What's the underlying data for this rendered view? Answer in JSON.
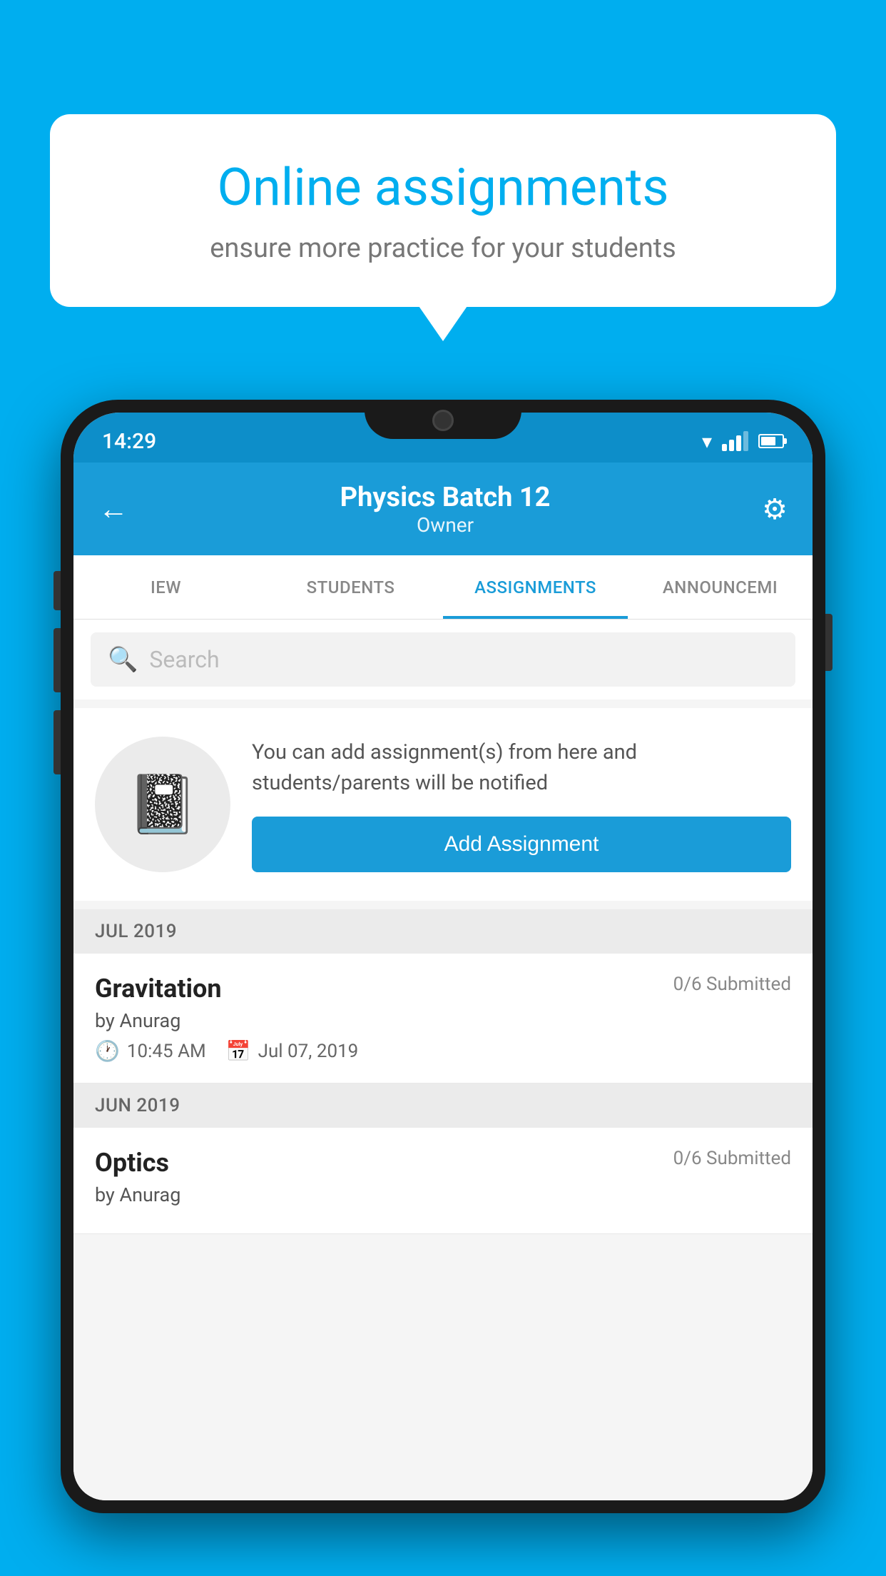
{
  "background_color": "#00AEEF",
  "speech_bubble": {
    "title": "Online assignments",
    "subtitle": "ensure more practice for your students"
  },
  "phone": {
    "status_bar": {
      "time": "14:29"
    },
    "app_bar": {
      "title": "Physics Batch 12",
      "subtitle": "Owner",
      "back_label": "←",
      "settings_label": "⚙"
    },
    "tabs": [
      {
        "label": "IEW",
        "active": false
      },
      {
        "label": "STUDENTS",
        "active": false
      },
      {
        "label": "ASSIGNMENTS",
        "active": true
      },
      {
        "label": "ANNOUNCEMI",
        "active": false
      }
    ],
    "search": {
      "placeholder": "Search"
    },
    "cta": {
      "description": "You can add assignment(s) from here and students/parents will be notified",
      "button_label": "Add Assignment"
    },
    "sections": [
      {
        "label": "JUL 2019",
        "assignments": [
          {
            "name": "Gravitation",
            "submitted": "0/6 Submitted",
            "by": "by Anurag",
            "time": "10:45 AM",
            "date": "Jul 07, 2019"
          }
        ]
      },
      {
        "label": "JUN 2019",
        "assignments": [
          {
            "name": "Optics",
            "submitted": "0/6 Submitted",
            "by": "by Anurag",
            "time": "",
            "date": ""
          }
        ]
      }
    ]
  }
}
